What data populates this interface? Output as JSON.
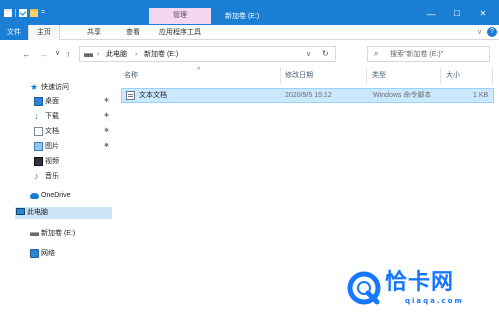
{
  "titlebar": {
    "contextual_tab": "管理",
    "title": "新加卷 (E:)",
    "minimize": "—",
    "maximize": "☐",
    "close": "✕",
    "qat_dropdown": "="
  },
  "ribbon": {
    "tabs": [
      "文件",
      "主页",
      "共享",
      "查看",
      "应用程序工具"
    ],
    "expand": "∨",
    "help": "?"
  },
  "navbar": {
    "back": "←",
    "forward": "→",
    "recent": "∨",
    "up": "↑",
    "breadcrumb": [
      "此电脑",
      "新加卷 (E:)"
    ],
    "breadcrumb_sep": "›",
    "address_dropdown": "∨",
    "refresh": "↻",
    "search_placeholder": "搜索\"新加卷 (E:)\""
  },
  "sidebar": {
    "quick_access": "快速访问",
    "pin": "✱",
    "items": [
      {
        "label": "桌面",
        "icon": "desktop-icon",
        "pinned": true
      },
      {
        "label": "下载",
        "icon": "download-icon",
        "pinned": true
      },
      {
        "label": "文档",
        "icon": "documents-icon",
        "pinned": true
      },
      {
        "label": "图片",
        "icon": "pictures-icon",
        "pinned": true
      },
      {
        "label": "视频",
        "icon": "videos-icon",
        "pinned": false
      },
      {
        "label": "音乐",
        "icon": "music-icon",
        "pinned": false
      }
    ],
    "onedrive": "OneDrive",
    "this_pc": "此电脑",
    "drive": "新加卷 (E:)",
    "network": "网络"
  },
  "columns": {
    "name": "名称",
    "modified": "修改日期",
    "type": "类型",
    "size": "大小",
    "sort_caret": "^"
  },
  "files": [
    {
      "name": "文本文档",
      "modified": "2020/9/5 15:12",
      "type": "Windows 命令脚本",
      "size": "1 KB",
      "selected": true
    }
  ],
  "watermark": {
    "text": "恰卡网",
    "url": "qiaqa.com"
  },
  "colors": {
    "accent": "#1a7fd4",
    "contextual_tab": "#f3d6f0",
    "selection": "#cce8ff",
    "watermark": "#1677ff"
  }
}
